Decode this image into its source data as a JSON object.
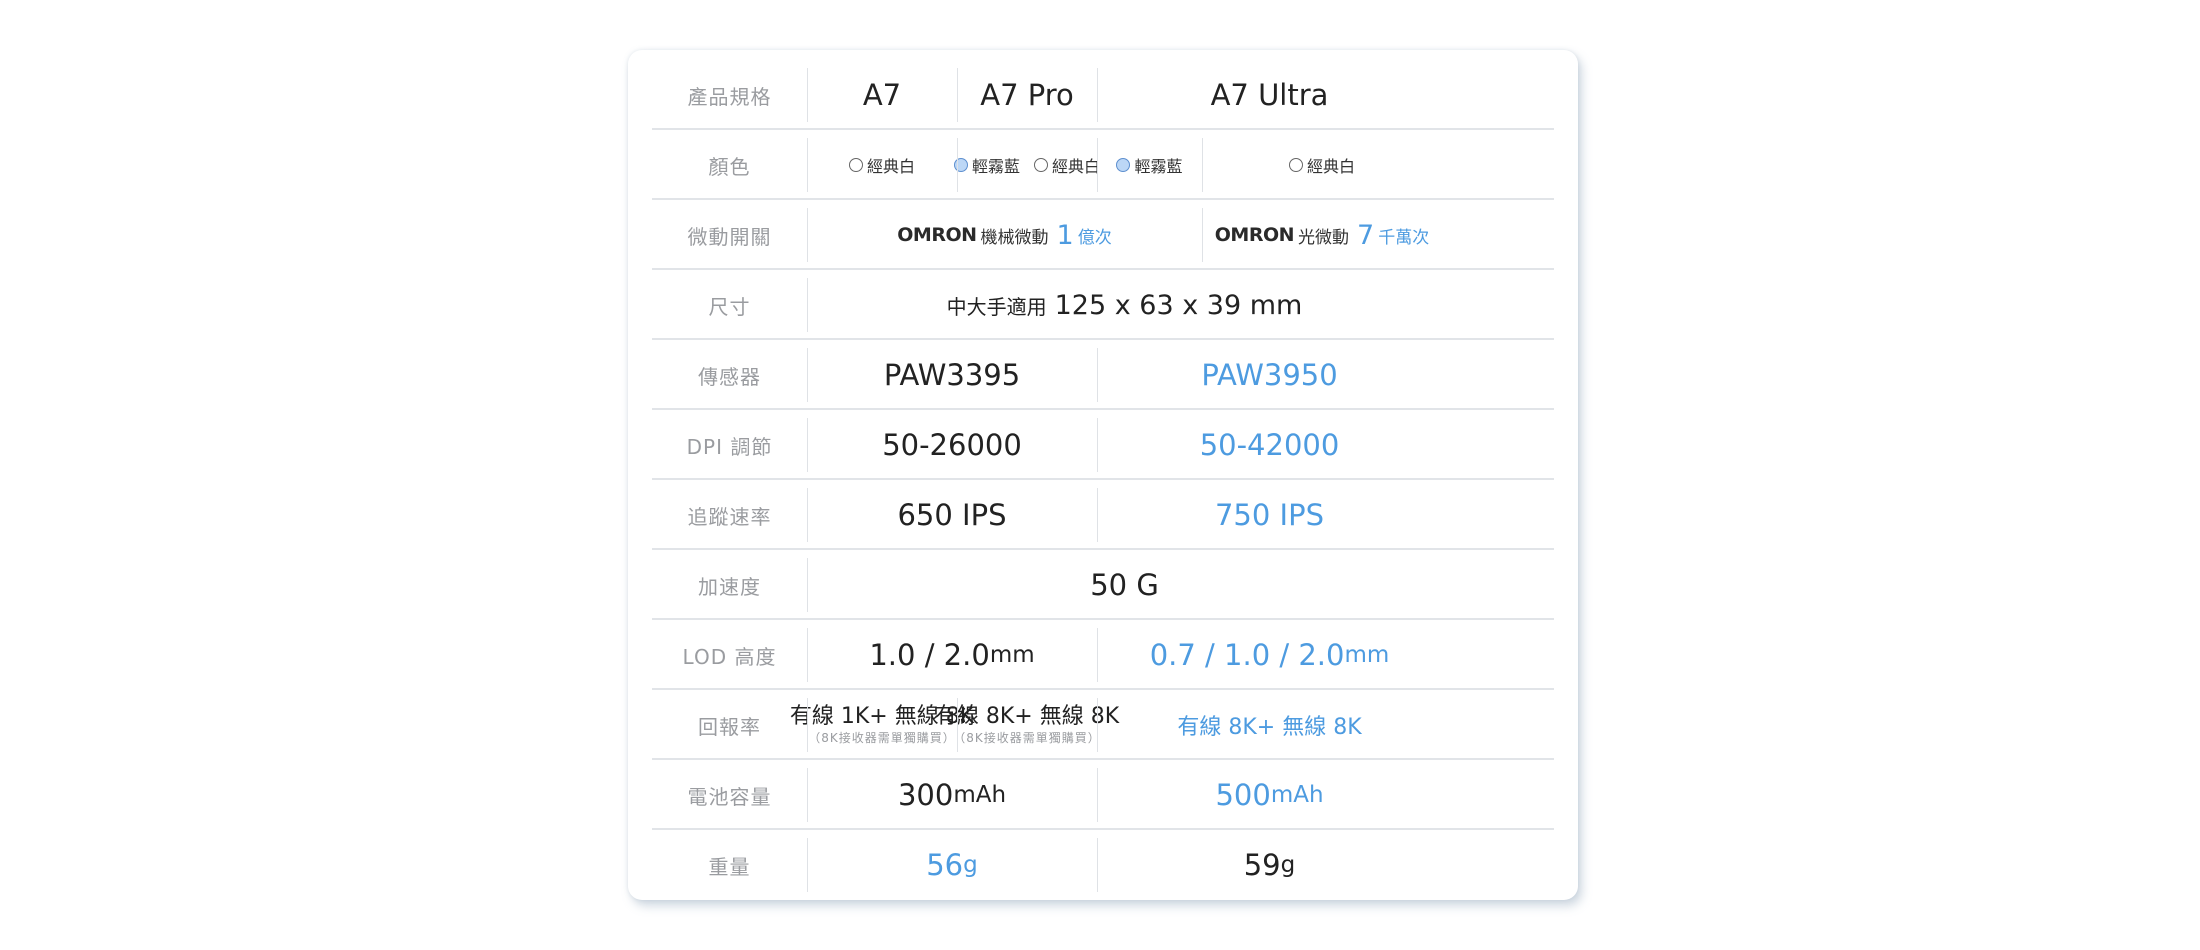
{
  "header": {
    "label": "產品規格",
    "models": [
      "A7",
      "A7 Pro",
      "A7 Ultra"
    ]
  },
  "rows": {
    "color": {
      "label": "顏色",
      "a7": "經典白",
      "pro_1": "輕霧藍",
      "pro_2": "經典白",
      "ultra_1": "輕霧藍",
      "ultra_2": "經典白"
    },
    "switch": {
      "label": "微動開關",
      "left_brand": "OMRON",
      "left_text": "機械微動",
      "left_num": "1",
      "left_unit": "億次",
      "right_brand": "OMRON",
      "right_text": "光微動",
      "right_num": "7",
      "right_unit": "千萬次"
    },
    "size": {
      "label": "尺寸",
      "text": "中大手適用",
      "value": "125 x 63 x 39 mm"
    },
    "sensor": {
      "label": "傳感器",
      "left": "PAW3395",
      "right": "PAW3950"
    },
    "dpi": {
      "label": "DPI 調節",
      "left": "50-26000",
      "right": "50-42000"
    },
    "ips": {
      "label": "追蹤速率",
      "left": "650 IPS",
      "right": "750 IPS"
    },
    "accel": {
      "label": "加速度",
      "value": "50 G"
    },
    "lod": {
      "label": "LOD 高度",
      "left": "1.0 / 2.0",
      "right": "0.7 / 1.0 / 2.0",
      "unit": "mm"
    },
    "polling": {
      "label": "回報率",
      "a7": "有線 1K+ 無線 8K",
      "a7_note": "（8K接收器需單獨購買）",
      "pro": "有線 8K+ 無線 8K",
      "pro_note": "（8K接收器需單獨購買）",
      "ultra": "有線 8K+ 無線 8K"
    },
    "battery": {
      "label": "電池容量",
      "left": "300",
      "right": "500",
      "unit": "mAh"
    },
    "weight": {
      "label": "重量",
      "left": "56",
      "right": "59",
      "unit": "g"
    }
  },
  "colors": {
    "accent": "#4d9be0",
    "divider": "#e1e4e8",
    "label": "#9a9ca0"
  },
  "icons": {
    "color_swatch": "circle-swatch-icon"
  }
}
